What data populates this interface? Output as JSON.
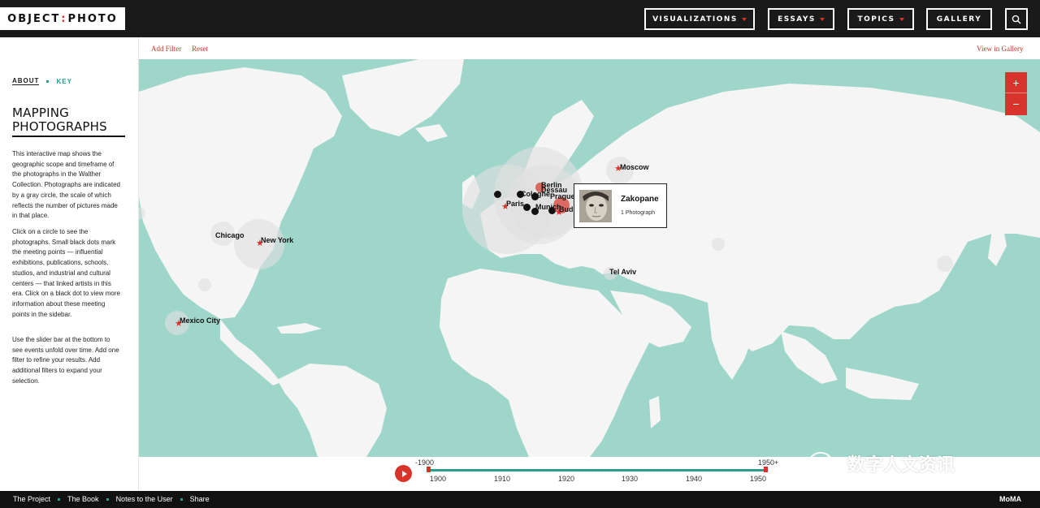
{
  "header": {
    "logo_left": "OBJECT",
    "logo_sep": ":",
    "logo_right": "PHOTO",
    "nav": [
      {
        "label": "VISUALIZATIONS",
        "dropdown": true
      },
      {
        "label": "ESSAYS",
        "dropdown": true
      },
      {
        "label": "TOPICS",
        "dropdown": true
      },
      {
        "label": "GALLERY",
        "dropdown": false
      }
    ],
    "search_icon": "search-icon"
  },
  "sidebar": {
    "tabs": {
      "about": "ABOUT",
      "key": "KEY"
    },
    "title_line1": "MAPPING",
    "title_line2": "PHOTOGRAPHS",
    "paragraphs": [
      "This interactive map shows the geographic scope and timeframe of the photographs in the Walther Collection. Photographs are indicated by a gray circle, the scale of which reflects the number of pictures made in that place.",
      "Click on a circle to see the photographs. Small black dots mark the meeting points — influential exhibitions, publications, schools, studios, and industrial and cultural centers — that linked artists in this era. Click on a black dot to view more information about these meeting points in the sidebar.",
      "Use the slider bar at the bottom to see events unfold over time. Add one filter to refine your results. Add additional filters to expand your selection."
    ]
  },
  "filterbar": {
    "add_filter": "Add Filter",
    "reset": "Reset",
    "view_gallery": "View in Gallery"
  },
  "map": {
    "colors": {
      "water": "#9ed6ca",
      "land": "#f5f5f5",
      "accent": "#d9342b"
    },
    "zoom_in": "+",
    "zoom_out": "−",
    "cities": {
      "moscow": "Moscow",
      "berlin": "Berlin",
      "dessau": "Dessau",
      "cologne": "Cologne",
      "prague": "Prague",
      "paris": "Paris",
      "munich": "Munich",
      "budapest": "Bud",
      "chicago": "Chicago",
      "new_york": "New York",
      "mexico_city": "Mexico City",
      "tel_aviv": "Tel Aviv"
    },
    "popup": {
      "title": "Zakopane",
      "subtitle": "1 Photograph"
    }
  },
  "timeline": {
    "start_label": "-1900",
    "end_label": "1950+",
    "ticks": [
      "1900",
      "1910",
      "1920",
      "1930",
      "1940",
      "1950"
    ],
    "range_start": 1900,
    "range_end": 1950
  },
  "footer": {
    "links": [
      "The Project",
      "The Book",
      "Notes to the User",
      "Share"
    ],
    "moma": "MoMA"
  },
  "watermark": {
    "text": "数字人文资讯"
  }
}
